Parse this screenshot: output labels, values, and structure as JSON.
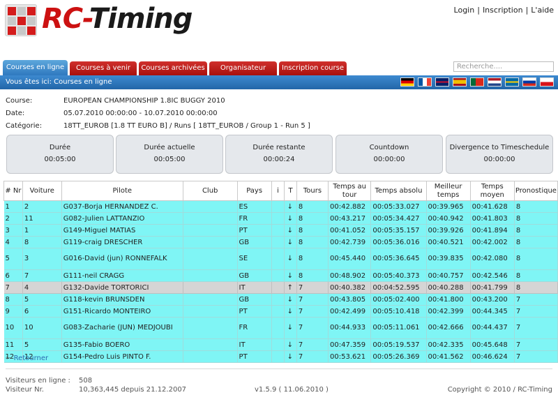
{
  "brand": {
    "rc": "RC",
    "dash": "-",
    "timing": "Timing"
  },
  "toplinks": {
    "login": "Login",
    "register": "Inscription",
    "help": "L'aide",
    "sep": "|"
  },
  "nav": {
    "tabs": [
      "Courses en ligne",
      "Courses à venir",
      "Courses archivées",
      "Organisateur",
      "Inscription course"
    ],
    "search_placeholder": "Recherche...."
  },
  "breadcrumb": "Vous êtes ici: Courses en ligne",
  "flags": [
    "de",
    "fr",
    "gb",
    "es",
    "pt",
    "nl",
    "se",
    "ru",
    "cz"
  ],
  "race": {
    "course_label": "Course:",
    "course": "EUROPEAN CHAMPIONSHIP 1.8IC BUGGY 2010",
    "date_label": "Date:",
    "date": "05.07.2010 00:00:00 - 10.07.2010 00:00:00",
    "category_label": "Catégorie:",
    "category": "18TT_EUROB [1.8 TT EURO B] / Runs [ 18TT_EUROB / Group 1 - Run 5 ]"
  },
  "timers": [
    {
      "title": "Durée",
      "value": "00:05:00"
    },
    {
      "title": "Durée actuelle",
      "value": "00:05:00"
    },
    {
      "title": "Durée restante",
      "value": "00:00:24"
    },
    {
      "title": "Countdown",
      "value": "00:00:00"
    },
    {
      "title": "Divergence to Timeschedule",
      "value": "00:00:00"
    }
  ],
  "table": {
    "headers": [
      "# Nr",
      "Voiture",
      "Pilote",
      "Club",
      "Pays",
      "i",
      "T",
      "Tours",
      "Temps au tour",
      "Temps absolu",
      "Meilleur temps",
      "Temps moyen",
      "Pronostique"
    ],
    "rows": [
      {
        "nr": "1",
        "car": "2",
        "pilot": "G037-Borja HERNANDEZ C.",
        "club": "",
        "country": "ES",
        "trend": "down",
        "laps": "8",
        "lap": "00:42.882",
        "abs": "00:05:33.027",
        "best": "00:39.965",
        "avg": "00:41.628",
        "prog": "8"
      },
      {
        "nr": "2",
        "car": "11",
        "pilot": "G082-Julien LATTANZIO",
        "club": "",
        "country": "FR",
        "trend": "down",
        "laps": "8",
        "lap": "00:43.217",
        "abs": "00:05:34.427",
        "best": "00:40.942",
        "avg": "00:41.803",
        "prog": "8"
      },
      {
        "nr": "3",
        "car": "1",
        "pilot": "G149-Miguel MATIAS",
        "club": "",
        "country": "PT",
        "trend": "down",
        "laps": "8",
        "lap": "00:41.052",
        "abs": "00:05:35.157",
        "best": "00:39.926",
        "avg": "00:41.894",
        "prog": "8"
      },
      {
        "nr": "4",
        "car": "8",
        "pilot": "G119-craig DRESCHER",
        "club": "",
        "country": "GB",
        "trend": "down",
        "laps": "8",
        "lap": "00:42.739",
        "abs": "00:05:36.016",
        "best": "00:40.521",
        "avg": "00:42.002",
        "prog": "8"
      },
      {
        "nr": "5",
        "car": "3",
        "pilot": "G016-David (jun) RONNEFALK",
        "club": "",
        "country": "SE",
        "trend": "down",
        "laps": "8",
        "lap": "00:45.440",
        "abs": "00:05:36.645",
        "best": "00:39.835",
        "avg": "00:42.080",
        "prog": "8"
      },
      {
        "nr": "6",
        "car": "7",
        "pilot": "G111-neil CRAGG",
        "club": "",
        "country": "GB",
        "trend": "down",
        "laps": "8",
        "lap": "00:48.902",
        "abs": "00:05:40.373",
        "best": "00:40.757",
        "avg": "00:42.546",
        "prog": "8"
      },
      {
        "nr": "7",
        "car": "4",
        "pilot": "G132-Davide TORTORICI",
        "club": "",
        "country": "IT",
        "trend": "up",
        "laps": "7",
        "lap": "00:40.382",
        "abs": "00:04:52.595",
        "best": "00:40.288",
        "avg": "00:41.799",
        "prog": "8"
      },
      {
        "nr": "8",
        "car": "5",
        "pilot": "G118-kevin BRUNSDEN",
        "club": "",
        "country": "GB",
        "trend": "down",
        "laps": "7",
        "lap": "00:43.805",
        "abs": "00:05:02.400",
        "best": "00:41.800",
        "avg": "00:43.200",
        "prog": "7"
      },
      {
        "nr": "9",
        "car": "6",
        "pilot": "G151-Ricardo MONTEIRO",
        "club": "",
        "country": "PT",
        "trend": "down",
        "laps": "7",
        "lap": "00:42.499",
        "abs": "00:05:10.418",
        "best": "00:42.399",
        "avg": "00:44.345",
        "prog": "7"
      },
      {
        "nr": "10",
        "car": "10",
        "pilot": "G083-Zacharie (JUN) MEDJOUBI",
        "club": "",
        "country": "FR",
        "trend": "down",
        "laps": "7",
        "lap": "00:44.933",
        "abs": "00:05:11.061",
        "best": "00:42.666",
        "avg": "00:44.437",
        "prog": "7"
      },
      {
        "nr": "11",
        "car": "5",
        "pilot": "G135-Fabio BOERO",
        "club": "",
        "country": "IT",
        "trend": "down",
        "laps": "7",
        "lap": "00:47.359",
        "abs": "00:05:19.537",
        "best": "00:42.335",
        "avg": "00:45.648",
        "prog": "7"
      },
      {
        "nr": "12",
        "car": "12",
        "pilot": "G154-Pedro Luis PINTO F.",
        "club": "",
        "country": "PT",
        "trend": "down",
        "laps": "7",
        "lap": "00:53.621",
        "abs": "00:05:26.369",
        "best": "00:41.562",
        "avg": "00:46.624",
        "prog": "7"
      }
    ],
    "highlight_row": 6
  },
  "back_link": "Retourner",
  "footer": {
    "visitors_online_label": "Visiteurs en ligne :",
    "visitors_online": "508",
    "visitor_nr_label": "Visiteur Nr.",
    "visitor_nr": "10,363,445 depuis 21.12.2007",
    "version": "v1.5.9 ( 11.06.2010 )",
    "copyright": "Copyright © 2010 / RC-Timing"
  },
  "colors": {
    "tab_red": "#b8161a",
    "tab_active": "#3a87cb",
    "row_cyan": "#7ff5f5",
    "row_grey": "#d5d5d5",
    "brand_red": "#cc1111"
  }
}
